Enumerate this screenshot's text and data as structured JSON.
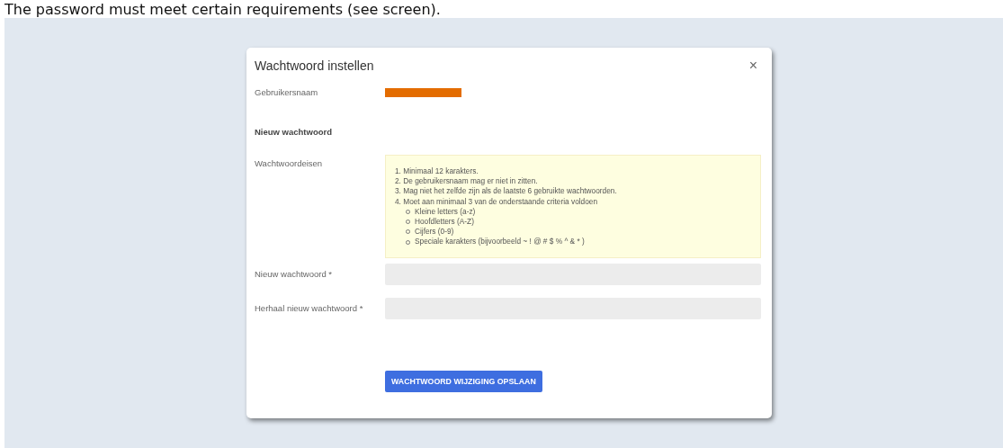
{
  "caption": "The password must meet certain requirements (see screen).",
  "dialog": {
    "title": "Wachtwoord instellen",
    "close": "×",
    "username": {
      "label": "Gebruikersnaam",
      "redacted": true
    },
    "section": "Nieuw wachtwoord",
    "requirements": {
      "label": "Wachtwoordeisen",
      "items": [
        "1. Minimaal 12 karakters.",
        "2. De gebruikersnaam mag er niet in zitten.",
        "3. Mag niet het zelfde zijn als de laatste 6 gebruikte wachtwoorden.",
        "4. Moet aan minimaal 3 van de onderstaande criteria voldoen"
      ],
      "criteria": [
        "Kleine letters (a-z)",
        "Hoofdletters (A-Z)",
        "Cijfers (0-9)",
        "Speciale karakters (bijvoorbeeld ~ ! @ # $ % ^ & * )"
      ]
    },
    "fields": [
      {
        "label": "Nieuw wachtwoord *"
      },
      {
        "label": "Herhaal nieuw wachtwoord *"
      }
    ],
    "save_button": "WACHTWOORD WIJZIGING OPSLAAN"
  }
}
